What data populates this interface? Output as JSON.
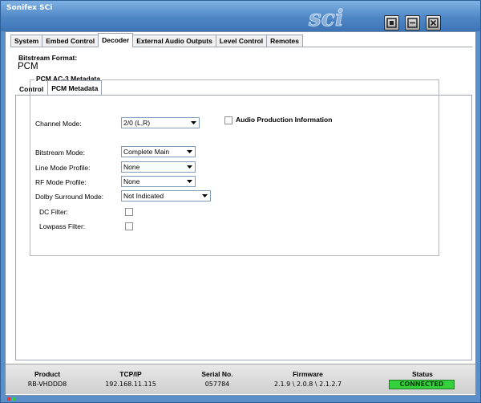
{
  "window": {
    "title": "Sonifex SCi",
    "logo_text": "sci"
  },
  "main_tabs": [
    {
      "label": "System"
    },
    {
      "label": "Embed Control"
    },
    {
      "label": "Decoder"
    },
    {
      "label": "External Audio Outputs"
    },
    {
      "label": "Level Control"
    },
    {
      "label": "Remotes"
    }
  ],
  "bitstream": {
    "label": "Bitstream Format:",
    "value": "PCM"
  },
  "sub_tabs": [
    {
      "label": "Control"
    },
    {
      "label": "PCM Metadata"
    }
  ],
  "metadata": {
    "group_title": "PCM AC-3 Metadata",
    "channel_mode": {
      "label": "Channel Mode:",
      "value": "2/0 (L,R)"
    },
    "audio_production_info": {
      "label": "Audio Production Information",
      "checked": false
    },
    "bitstream_mode": {
      "label": "Bitstream Mode:",
      "value": "Complete Main"
    },
    "line_mode_profile": {
      "label": "Line Mode Profile:",
      "value": "None"
    },
    "rf_mode_profile": {
      "label": "RF Mode Profile:",
      "value": "None"
    },
    "dolby_surround_mode": {
      "label": "Dolby Surround Mode:",
      "value": "Not Indicated"
    },
    "dc_filter": {
      "label": "DC Filter:",
      "checked": false
    },
    "lowpass_filter": {
      "label": "Lowpass Filter:",
      "checked": false
    }
  },
  "status_bar": {
    "product": {
      "label": "Product",
      "value": "RB-VHDDD8"
    },
    "tcpip": {
      "label": "TCP/IP",
      "value": "192.168.11.115"
    },
    "serial": {
      "label": "Serial No.",
      "value": "057784"
    },
    "firmware": {
      "label": "Firmware",
      "value": "2.1.9 \\ 2.0.8 \\ 2.1.2.7"
    },
    "status": {
      "label": "Status",
      "value": "CONNECTED",
      "color": "#35d13c"
    }
  },
  "colors": {
    "title_bar": "#4f87c6",
    "connected": "#35d13c"
  }
}
